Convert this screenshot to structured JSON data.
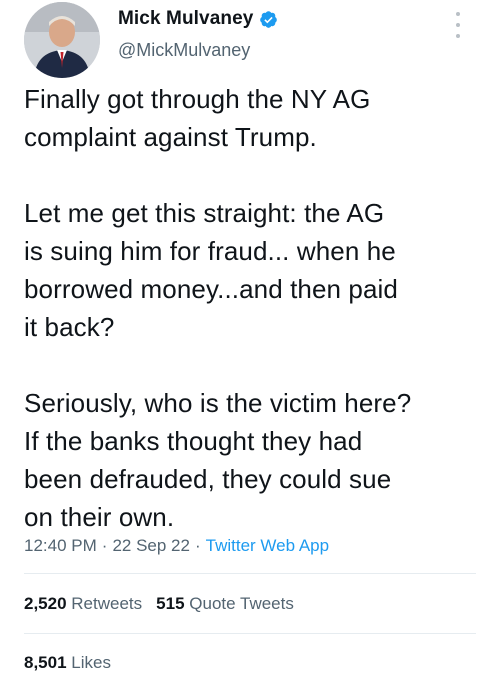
{
  "author": {
    "display_name": "Mick Mulvaney",
    "handle": "@MickMulvaney",
    "verified_icon": "verified-badge-icon",
    "avatar_icon": "profile-photo"
  },
  "tweet": {
    "text": "Finally got through the NY AG\ncomplaint against Trump.\n\nLet me get this straight:  the AG\nis suing him for fraud... when he\nborrowed money...and then paid\nit back?\n\nSeriously, who is the victim here?\nIf the banks thought they had\nbeen defrauded, they could sue\non their own.",
    "time": "12:40 PM",
    "separator": "·",
    "date": "22 Sep 22",
    "source": "Twitter Web App"
  },
  "stats": {
    "retweets_count": "2,520",
    "retweets_label": "Retweets",
    "quotes_count": "515",
    "quotes_label": "Quote Tweets",
    "likes_count": "8,501",
    "likes_label": "Likes"
  },
  "colors": {
    "text": "#0f1419",
    "secondary": "#536471",
    "link": "#1d9bf0",
    "divider": "#e6ecf0"
  }
}
